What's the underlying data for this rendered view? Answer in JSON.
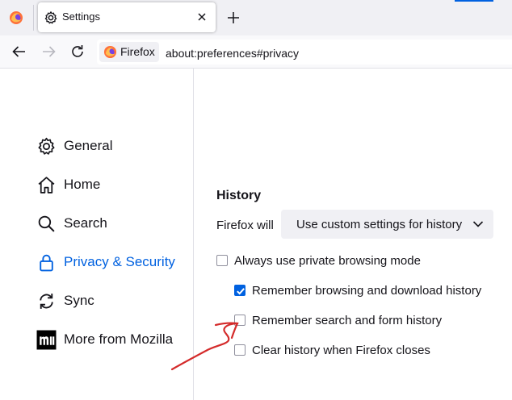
{
  "tabs": {
    "active_title": "Settings",
    "new_tab_icon": "plus-icon"
  },
  "navbar": {
    "identity_label": "Firefox",
    "url": "about:preferences#privacy"
  },
  "sidebar": {
    "items": [
      {
        "label": "General",
        "icon": "gear-icon"
      },
      {
        "label": "Home",
        "icon": "home-icon"
      },
      {
        "label": "Search",
        "icon": "search-icon"
      },
      {
        "label": "Privacy & Security",
        "icon": "lock-icon"
      },
      {
        "label": "Sync",
        "icon": "sync-icon"
      },
      {
        "label": "More from Mozilla",
        "icon": "mozilla-icon"
      }
    ],
    "selected_index": 3
  },
  "history": {
    "title": "History",
    "mode_label": "Firefox will",
    "mode_value": "Use custom settings for history",
    "options": [
      {
        "label": "Always use private browsing mode",
        "checked": false
      },
      {
        "label": "Remember browsing and download history",
        "checked": true
      },
      {
        "label": "Remember search and form history",
        "checked": false
      },
      {
        "label": "Clear history when Firefox closes",
        "checked": false
      }
    ]
  },
  "colors": {
    "accent": "#0061e0",
    "annotation": "#d42b2b"
  }
}
